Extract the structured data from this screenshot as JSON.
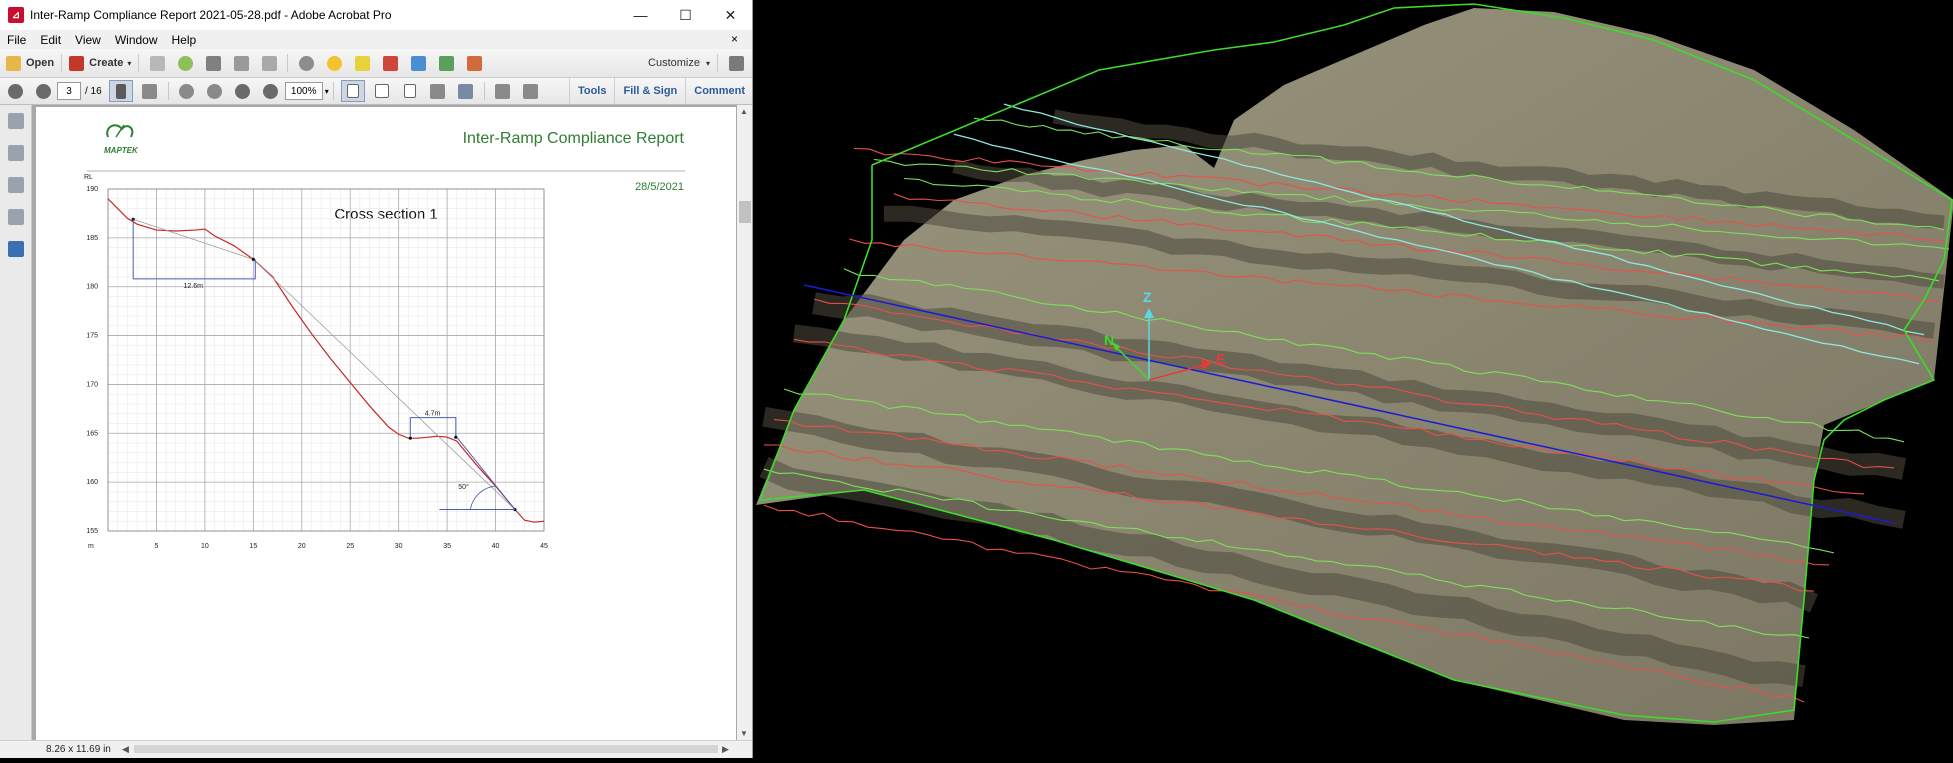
{
  "window": {
    "title": "Inter-Ramp Compliance Report 2021-05-28.pdf - Adobe Acrobat Pro",
    "app_icon": "pdf-icon",
    "controls": [
      "—",
      "☐",
      "✕"
    ]
  },
  "menu": [
    "File",
    "Edit",
    "View",
    "Window",
    "Help"
  ],
  "menu_close": "×",
  "toolbar1": {
    "open_label": "Open",
    "create_label": "Create",
    "customize_label": "Customize"
  },
  "toolbar2": {
    "page_current": "3",
    "page_total": "/ 16",
    "zoom": "100%",
    "tabs": [
      "Tools",
      "Fill & Sign",
      "Comment"
    ]
  },
  "statusbar": {
    "page_size": "8.26 x 11.69 in"
  },
  "report": {
    "logo_text": "MAPTEK",
    "title": "Inter-Ramp Compliance Report",
    "date": "28/5/2021",
    "accent_color": "#2e7d32"
  },
  "chart_data": {
    "type": "line",
    "title": "Cross section 1",
    "xlabel": "m",
    "ylabel": "RL",
    "xlim": [
      0,
      45
    ],
    "ylim": [
      155,
      190
    ],
    "xticks": [
      "5",
      "10",
      "15",
      "20",
      "25",
      "30",
      "35",
      "40",
      "45"
    ],
    "yticks": [
      "155",
      "160",
      "165",
      "170",
      "175",
      "180",
      "185",
      "190"
    ],
    "grid": true,
    "series": [
      {
        "color": "#c62828",
        "x": [
          0,
          1,
          2,
          3,
          5,
          7,
          9,
          10,
          11,
          13,
          15,
          17,
          19,
          21,
          23,
          25,
          27,
          29,
          30,
          31,
          32,
          33,
          34,
          35,
          36,
          37,
          38,
          40,
          42,
          43,
          44,
          45
        ],
        "y": [
          189,
          188,
          187,
          186.4,
          185.8,
          185.7,
          185.8,
          185.9,
          185.2,
          184.2,
          182.8,
          181,
          178,
          175.2,
          172.6,
          170.2,
          167.8,
          165.6,
          164.9,
          164.5,
          164.5,
          164.6,
          164.7,
          164.6,
          164.2,
          163,
          161.8,
          159.6,
          157.2,
          156.1,
          155.9,
          156
        ]
      },
      {
        "color": "#9e9e9e",
        "x": [
          2.6,
          15,
          42
        ],
        "y": [
          186.9,
          182.8,
          157.2
        ]
      }
    ],
    "annotations": [
      "12.6m",
      "4.7m",
      "50°"
    ]
  },
  "viewer3d": {
    "axis_labels": [
      "Z",
      "N",
      "E"
    ],
    "colors": {
      "terrain": "#8a8670",
      "boundary": "#3ddc2a",
      "toe": "#e8504a",
      "crest": "#7ee05a",
      "design": "#8ee8e0",
      "section": "#1a1ad8"
    }
  }
}
